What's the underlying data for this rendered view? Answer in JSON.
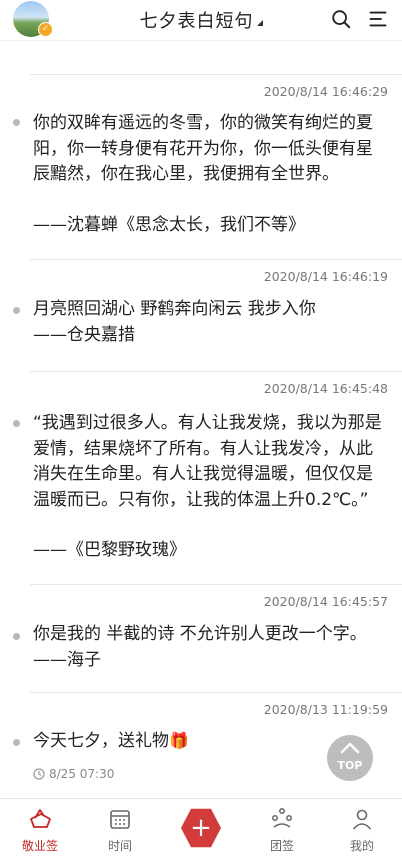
{
  "header": {
    "title": "七夕表白短句",
    "avatar_badge": "✓",
    "icons": [
      "search-icon",
      "menu-icon"
    ]
  },
  "posts": [
    {
      "time": "2020/8/14 16:46:29",
      "body": "你的双眸有遥远的冬雪，你的微笑有绚烂的夏阳，你一转身便有花开为你，你一低头便有星辰黯然，你在我心里，我便拥有全世界。",
      "author": "——沈暮蝉《思念太长，我们不等》"
    },
    {
      "time": "2020/8/14 16:46:19",
      "body": "月亮照回湖心 野鹤奔向闲云 我步入你",
      "author": "——仓央嘉措"
    },
    {
      "time": "2020/8/14 16:45:48",
      "body": "“我遇到过很多人。有人让我发烧，我以为那是爱情，结果烧坏了所有。有人让我发冷，从此消失在生命里。有人让我觉得温暖，但仅仅是温暖而已。只有你，让我的体温上升0.2℃。”",
      "author": "——《巴黎野玫瑰》"
    },
    {
      "time": "2020/8/14 16:45:57",
      "body": "你是我的 半截的诗 不允许别人更改一个字。",
      "author": "——海子"
    },
    {
      "time": "2020/8/13 11:19:59",
      "body": "今天七夕，送礼物",
      "gift_icon": "🎁",
      "scheduled": "8/25 07:30"
    }
  ],
  "top_button": {
    "label": "TOP"
  },
  "bottom_nav": [
    {
      "label": "敬业签",
      "icon": "cup-icon",
      "active": true
    },
    {
      "label": "时间",
      "icon": "calendar-icon",
      "active": false
    },
    {
      "label": "+",
      "icon": "add-icon",
      "active": false
    },
    {
      "label": "团签",
      "icon": "team-icon",
      "active": false
    },
    {
      "label": "我的",
      "icon": "user-icon",
      "active": false
    }
  ],
  "colors": {
    "accent": "#c62828",
    "add_button": "#d23b3b",
    "separator": "#e6e6e6",
    "timestamp": "#777777"
  }
}
